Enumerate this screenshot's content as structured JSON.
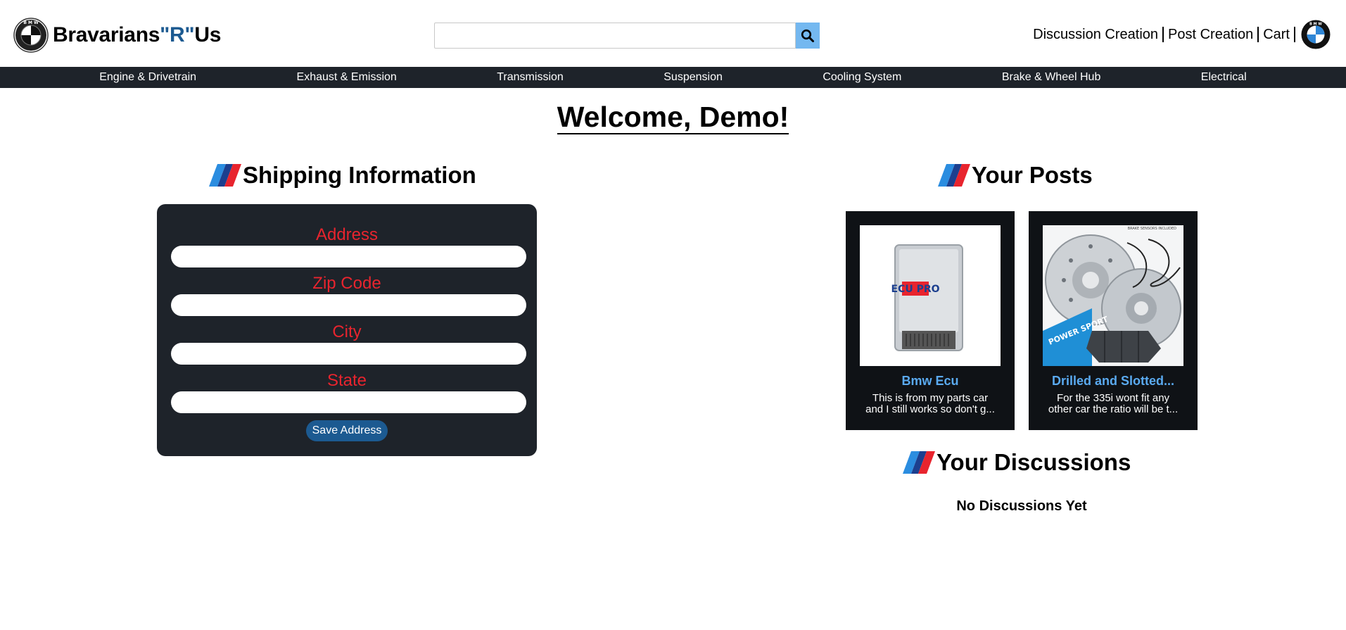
{
  "header": {
    "brand_prefix": "Bravarians",
    "brand_r": "\"R\"",
    "brand_suffix": "Us",
    "logo_icon": "bmw-roundel-icon",
    "search": {
      "placeholder": "",
      "value": "",
      "button_icon": "search-icon"
    },
    "links": [
      {
        "label": "Discussion Creation"
      },
      {
        "label": "Post Creation"
      },
      {
        "label": "Cart"
      }
    ],
    "profile_icon": "bmw-roundel-icon"
  },
  "nav": {
    "items": [
      {
        "label": "Engine & Drivetrain"
      },
      {
        "label": "Exhaust & Emission"
      },
      {
        "label": "Transmission"
      },
      {
        "label": "Suspension"
      },
      {
        "label": "Cooling System"
      },
      {
        "label": "Brake & Wheel Hub"
      },
      {
        "label": "Electrical"
      }
    ]
  },
  "welcome": {
    "title": "Welcome, Demo!"
  },
  "shipping": {
    "title": "Shipping Information",
    "fields": [
      {
        "label": "Address",
        "value": ""
      },
      {
        "label": "Zip Code",
        "value": ""
      },
      {
        "label": "City",
        "value": ""
      },
      {
        "label": "State",
        "value": ""
      }
    ],
    "save_label": "Save Address"
  },
  "posts": {
    "title": "Your Posts",
    "items": [
      {
        "title": "Bmw Ecu",
        "desc_line1": "This is from my parts car",
        "desc_line2": "and I still works so don't g...",
        "image_icon": "ecu-module-image",
        "image_text": "ECU PRO"
      },
      {
        "title": "Drilled and Slotted...",
        "desc_line1": "For the 335i wont fit any",
        "desc_line2": "other car the ratio will be t...",
        "image_icon": "brake-rotors-pads-image",
        "image_text": "POWER SPORT",
        "image_caption": "BRAKE SENSORS INCLUDED"
      }
    ]
  },
  "discussions": {
    "title": "Your Discussions",
    "empty_text": "No Discussions Yet"
  },
  "colors": {
    "nav_bg": "#1e232a",
    "accent_blue": "#1c5a91",
    "search_btn": "#74b8f0",
    "label_red": "#e8242e",
    "post_title": "#5aaaf0"
  }
}
